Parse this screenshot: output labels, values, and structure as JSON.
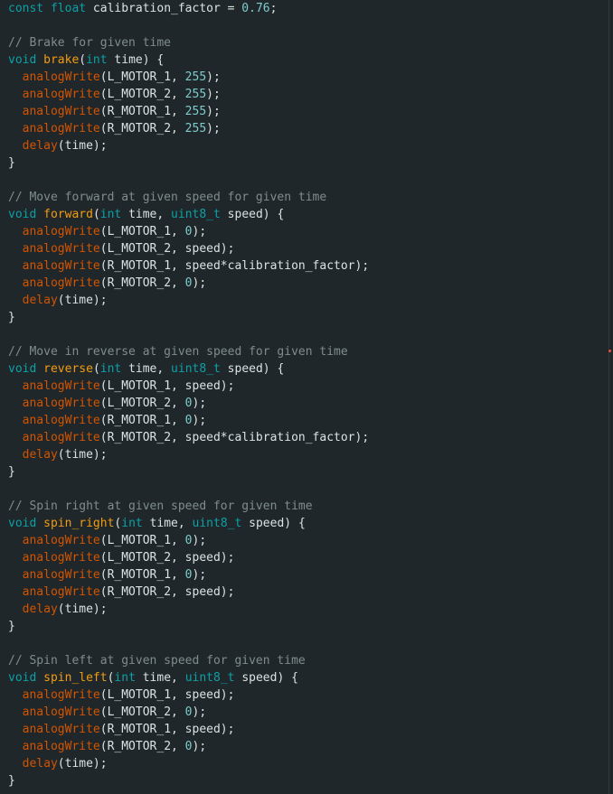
{
  "editor": {
    "theme_colors": {
      "background": "#1f272a",
      "keyword": "#0ca1a6",
      "comment": "#7f8c8d",
      "function_name": "#f39c12",
      "builtin_call": "#d35400",
      "number": "#7fcbcd",
      "text": "#dae3e3",
      "marker": "#e74c3c"
    },
    "lines": [
      [
        {
          "t": "keyword",
          "s": "const float "
        },
        {
          "t": "text",
          "s": "calibration_factor = "
        },
        {
          "t": "number",
          "s": "0.76"
        },
        {
          "t": "text",
          "s": ";"
        }
      ],
      [],
      [
        {
          "t": "comment",
          "s": "// Brake for given time"
        }
      ],
      [
        {
          "t": "keyword",
          "s": "void "
        },
        {
          "t": "function",
          "s": "brake"
        },
        {
          "t": "text",
          "s": "("
        },
        {
          "t": "keyword",
          "s": "int "
        },
        {
          "t": "text",
          "s": "time) {"
        }
      ],
      [
        {
          "t": "text",
          "s": "  "
        },
        {
          "t": "builtin",
          "s": "analogWrite"
        },
        {
          "t": "text",
          "s": "(L_MOTOR_1, "
        },
        {
          "t": "number",
          "s": "255"
        },
        {
          "t": "text",
          "s": ");"
        }
      ],
      [
        {
          "t": "text",
          "s": "  "
        },
        {
          "t": "builtin",
          "s": "analogWrite"
        },
        {
          "t": "text",
          "s": "(L_MOTOR_2, "
        },
        {
          "t": "number",
          "s": "255"
        },
        {
          "t": "text",
          "s": ");"
        }
      ],
      [
        {
          "t": "text",
          "s": "  "
        },
        {
          "t": "builtin",
          "s": "analogWrite"
        },
        {
          "t": "text",
          "s": "(R_MOTOR_1, "
        },
        {
          "t": "number",
          "s": "255"
        },
        {
          "t": "text",
          "s": ");"
        }
      ],
      [
        {
          "t": "text",
          "s": "  "
        },
        {
          "t": "builtin",
          "s": "analogWrite"
        },
        {
          "t": "text",
          "s": "(R_MOTOR_2, "
        },
        {
          "t": "number",
          "s": "255"
        },
        {
          "t": "text",
          "s": ");"
        }
      ],
      [
        {
          "t": "text",
          "s": "  "
        },
        {
          "t": "builtin",
          "s": "delay"
        },
        {
          "t": "text",
          "s": "(time);"
        }
      ],
      [
        {
          "t": "text",
          "s": "}"
        }
      ],
      [],
      [
        {
          "t": "comment",
          "s": "// Move forward at given speed for given time"
        }
      ],
      [
        {
          "t": "keyword",
          "s": "void "
        },
        {
          "t": "function",
          "s": "forward"
        },
        {
          "t": "text",
          "s": "("
        },
        {
          "t": "keyword",
          "s": "int "
        },
        {
          "t": "text",
          "s": "time, "
        },
        {
          "t": "keyword",
          "s": "uint8_t "
        },
        {
          "t": "text",
          "s": "speed) {"
        }
      ],
      [
        {
          "t": "text",
          "s": "  "
        },
        {
          "t": "builtin",
          "s": "analogWrite"
        },
        {
          "t": "text",
          "s": "(L_MOTOR_1, "
        },
        {
          "t": "number",
          "s": "0"
        },
        {
          "t": "text",
          "s": ");"
        }
      ],
      [
        {
          "t": "text",
          "s": "  "
        },
        {
          "t": "builtin",
          "s": "analogWrite"
        },
        {
          "t": "text",
          "s": "(L_MOTOR_2, speed);"
        }
      ],
      [
        {
          "t": "text",
          "s": "  "
        },
        {
          "t": "builtin",
          "s": "analogWrite"
        },
        {
          "t": "text",
          "s": "(R_MOTOR_1, speed*calibration_factor);"
        }
      ],
      [
        {
          "t": "text",
          "s": "  "
        },
        {
          "t": "builtin",
          "s": "analogWrite"
        },
        {
          "t": "text",
          "s": "(R_MOTOR_2, "
        },
        {
          "t": "number",
          "s": "0"
        },
        {
          "t": "text",
          "s": ");"
        }
      ],
      [
        {
          "t": "text",
          "s": "  "
        },
        {
          "t": "builtin",
          "s": "delay"
        },
        {
          "t": "text",
          "s": "(time);"
        }
      ],
      [
        {
          "t": "text",
          "s": "}"
        }
      ],
      [],
      [
        {
          "t": "comment",
          "s": "// Move in reverse at given speed for given time"
        }
      ],
      [
        {
          "t": "keyword",
          "s": "void "
        },
        {
          "t": "function",
          "s": "reverse"
        },
        {
          "t": "text",
          "s": "("
        },
        {
          "t": "keyword",
          "s": "int "
        },
        {
          "t": "text",
          "s": "time, "
        },
        {
          "t": "keyword",
          "s": "uint8_t "
        },
        {
          "t": "text",
          "s": "speed) {"
        }
      ],
      [
        {
          "t": "text",
          "s": "  "
        },
        {
          "t": "builtin",
          "s": "analogWrite"
        },
        {
          "t": "text",
          "s": "(L_MOTOR_1, speed);"
        }
      ],
      [
        {
          "t": "text",
          "s": "  "
        },
        {
          "t": "builtin",
          "s": "analogWrite"
        },
        {
          "t": "text",
          "s": "(L_MOTOR_2, "
        },
        {
          "t": "number",
          "s": "0"
        },
        {
          "t": "text",
          "s": ");"
        }
      ],
      [
        {
          "t": "text",
          "s": "  "
        },
        {
          "t": "builtin",
          "s": "analogWrite"
        },
        {
          "t": "text",
          "s": "(R_MOTOR_1, "
        },
        {
          "t": "number",
          "s": "0"
        },
        {
          "t": "text",
          "s": ");"
        }
      ],
      [
        {
          "t": "text",
          "s": "  "
        },
        {
          "t": "builtin",
          "s": "analogWrite"
        },
        {
          "t": "text",
          "s": "(R_MOTOR_2, speed*calibration_factor);"
        }
      ],
      [
        {
          "t": "text",
          "s": "  "
        },
        {
          "t": "builtin",
          "s": "delay"
        },
        {
          "t": "text",
          "s": "(time);"
        }
      ],
      [
        {
          "t": "text",
          "s": "}"
        }
      ],
      [],
      [
        {
          "t": "comment",
          "s": "// Spin right at given speed for given time"
        }
      ],
      [
        {
          "t": "keyword",
          "s": "void "
        },
        {
          "t": "function",
          "s": "spin_right"
        },
        {
          "t": "text",
          "s": "("
        },
        {
          "t": "keyword",
          "s": "int "
        },
        {
          "t": "text",
          "s": "time, "
        },
        {
          "t": "keyword",
          "s": "uint8_t "
        },
        {
          "t": "text",
          "s": "speed) {"
        }
      ],
      [
        {
          "t": "text",
          "s": "  "
        },
        {
          "t": "builtin",
          "s": "analogWrite"
        },
        {
          "t": "text",
          "s": "(L_MOTOR_1, "
        },
        {
          "t": "number",
          "s": "0"
        },
        {
          "t": "text",
          "s": ");"
        }
      ],
      [
        {
          "t": "text",
          "s": "  "
        },
        {
          "t": "builtin",
          "s": "analogWrite"
        },
        {
          "t": "text",
          "s": "(L_MOTOR_2, speed);"
        }
      ],
      [
        {
          "t": "text",
          "s": "  "
        },
        {
          "t": "builtin",
          "s": "analogWrite"
        },
        {
          "t": "text",
          "s": "(R_MOTOR_1, "
        },
        {
          "t": "number",
          "s": "0"
        },
        {
          "t": "text",
          "s": ");"
        }
      ],
      [
        {
          "t": "text",
          "s": "  "
        },
        {
          "t": "builtin",
          "s": "analogWrite"
        },
        {
          "t": "text",
          "s": "(R_MOTOR_2, speed);"
        }
      ],
      [
        {
          "t": "text",
          "s": "  "
        },
        {
          "t": "builtin",
          "s": "delay"
        },
        {
          "t": "text",
          "s": "(time);"
        }
      ],
      [
        {
          "t": "text",
          "s": "}"
        }
      ],
      [],
      [
        {
          "t": "comment",
          "s": "// Spin left at given speed for given time"
        }
      ],
      [
        {
          "t": "keyword",
          "s": "void "
        },
        {
          "t": "function",
          "s": "spin_left"
        },
        {
          "t": "text",
          "s": "("
        },
        {
          "t": "keyword",
          "s": "int "
        },
        {
          "t": "text",
          "s": "time, "
        },
        {
          "t": "keyword",
          "s": "uint8_t "
        },
        {
          "t": "text",
          "s": "speed) {"
        }
      ],
      [
        {
          "t": "text",
          "s": "  "
        },
        {
          "t": "builtin",
          "s": "analogWrite"
        },
        {
          "t": "text",
          "s": "(L_MOTOR_1, speed);"
        }
      ],
      [
        {
          "t": "text",
          "s": "  "
        },
        {
          "t": "builtin",
          "s": "analogWrite"
        },
        {
          "t": "text",
          "s": "(L_MOTOR_2, "
        },
        {
          "t": "number",
          "s": "0"
        },
        {
          "t": "text",
          "s": ");"
        }
      ],
      [
        {
          "t": "text",
          "s": "  "
        },
        {
          "t": "builtin",
          "s": "analogWrite"
        },
        {
          "t": "text",
          "s": "(R_MOTOR_1, speed);"
        }
      ],
      [
        {
          "t": "text",
          "s": "  "
        },
        {
          "t": "builtin",
          "s": "analogWrite"
        },
        {
          "t": "text",
          "s": "(R_MOTOR_2, "
        },
        {
          "t": "number",
          "s": "0"
        },
        {
          "t": "text",
          "s": ");"
        }
      ],
      [
        {
          "t": "text",
          "s": "  "
        },
        {
          "t": "builtin",
          "s": "delay"
        },
        {
          "t": "text",
          "s": "(time);"
        }
      ],
      [
        {
          "t": "text",
          "s": "}"
        }
      ]
    ]
  }
}
